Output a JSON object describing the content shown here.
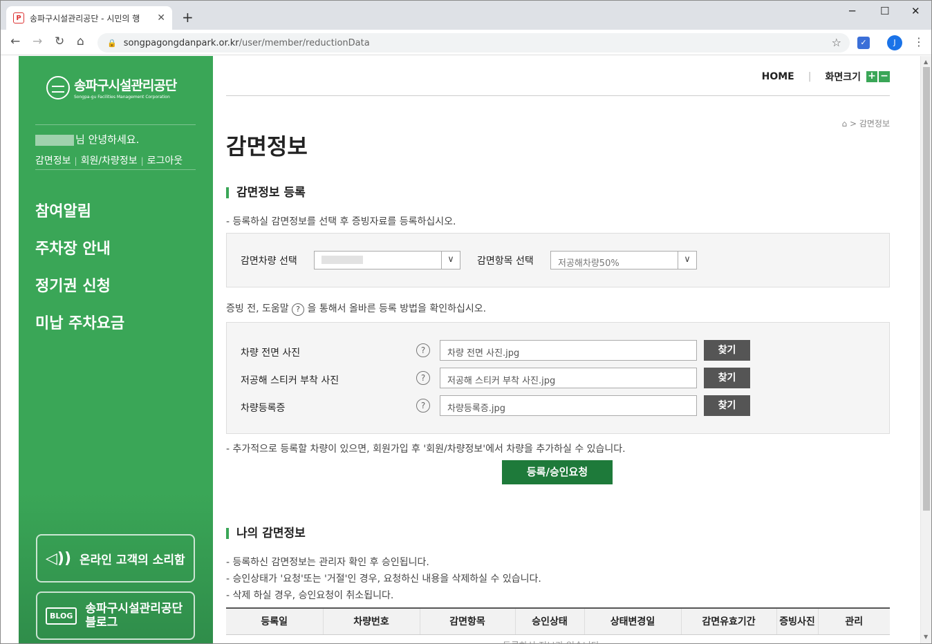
{
  "browser": {
    "tab_title": "송파구시설관리공단 - 시민의 행",
    "favicon": "P",
    "url_host": "songpagongdanpark.or.kr",
    "url_path": "/user/member/reductionData",
    "profile_initial": "J"
  },
  "sidebar": {
    "logo_text": "송파구시설관리공단",
    "logo_sub": "Songpa-gu Facilities Management Corporation",
    "greeting": "님 안녕하세요.",
    "links": [
      "감면정보",
      "회원/차량정보",
      "로그아웃"
    ],
    "menu": [
      "참여알림",
      "주차장 안내",
      "정기권 신청",
      "미납 주차요금"
    ],
    "voice_box": "온라인 고객의 소리함",
    "blog_icon": "BLOG",
    "blog_box_line1": "송파구시설관리공단",
    "blog_box_line2": "블로그"
  },
  "header": {
    "home": "HOME",
    "font_size": "화면크기",
    "plus": "+",
    "minus": "−"
  },
  "breadcrumb": {
    "sep": ">",
    "current": "감면정보"
  },
  "page_title": "감면정보",
  "register": {
    "section_title": "감면정보 등록",
    "desc": "- 등록하실 감면정보를 선택 후 증빙자료를 등록하십시오.",
    "vehicle_label": "감면차량 선택",
    "item_label": "감면항목 선택",
    "item_value": "저공해차량50%",
    "help_prefix": "증빙 전, 도움말",
    "help_suffix": "을 통해서 올바른 등록 방법을 확인하십시오.",
    "files": [
      {
        "label": "차량 전면 사진",
        "value": "차량 전면 사진.jpg",
        "button": "찾기"
      },
      {
        "label": "저공해 스티커 부착 사진",
        "value": "저공해 스티커 부착 사진.jpg",
        "button": "찾기"
      },
      {
        "label": "차량등록증",
        "value": "차량등록증.jpg",
        "button": "찾기"
      }
    ],
    "note": "- 추가적으로 등록할 차량이 있으면, 회원가입 후 '회원/차량정보'에서 차량을 추가하실 수 있습니다.",
    "submit": "등록/승인요청"
  },
  "my_info": {
    "section_title": "나의 감면정보",
    "notes": [
      "- 등록하신 감면정보는 관리자 확인 후 승인됩니다.",
      "- 승인상태가 '요청'또는 '거절'인 경우, 요청하신 내용을 삭제하실 수 있습니다.",
      "- 삭제 하실 경우, 승인요청이 취소됩니다."
    ],
    "columns": [
      "등록일",
      "차량번호",
      "감면항목",
      "승인상태",
      "상태변경일",
      "감면유효기간",
      "증빙사진",
      "관리"
    ],
    "empty": "등록하신 정보가 없습니다."
  }
}
